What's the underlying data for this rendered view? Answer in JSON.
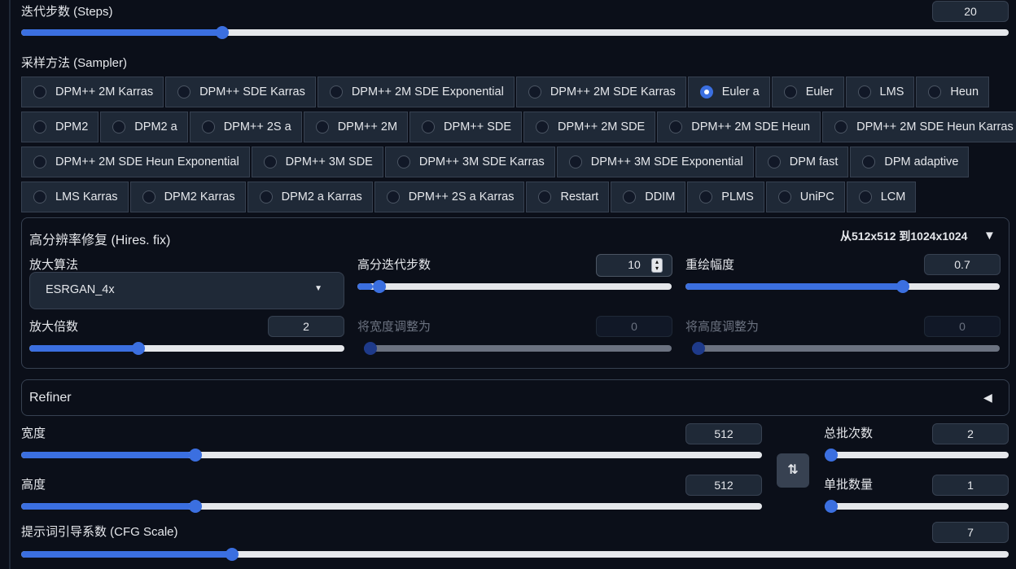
{
  "steps": {
    "label": "迭代步数 (Steps)",
    "value": "20",
    "progress": 0.2
  },
  "sampler": {
    "label": "采样方法 (Sampler)",
    "selected": "Euler a",
    "rows": [
      [
        "DPM++ 2M Karras",
        "DPM++ SDE Karras",
        "DPM++ 2M SDE Exponential",
        "DPM++ 2M SDE Karras",
        "Euler a",
        "Euler",
        "LMS",
        "Heun"
      ],
      [
        "DPM2",
        "DPM2 a",
        "DPM++ 2S a",
        "DPM++ 2M",
        "DPM++ SDE",
        "DPM++ 2M SDE",
        "DPM++ 2M SDE Heun",
        "DPM++ 2M SDE Heun Karras"
      ],
      [
        "DPM++ 2M SDE Heun Exponential",
        "DPM++ 3M SDE",
        "DPM++ 3M SDE Karras",
        "DPM++ 3M SDE Exponential",
        "DPM fast",
        "DPM adaptive"
      ],
      [
        "LMS Karras",
        "DPM2 Karras",
        "DPM2 a Karras",
        "DPM++ 2S a Karras",
        "Restart",
        "DDIM",
        "PLMS",
        "UniPC",
        "LCM"
      ]
    ]
  },
  "hires": {
    "title": "高分辨率修复 (Hires. fix)",
    "summary": "从512x512 到1024x1024",
    "toggle_icon": "▼",
    "upscaler": {
      "label": "放大算法",
      "value": "ESRGAN_4x"
    },
    "hires_steps": {
      "label": "高分迭代步数",
      "value": "10",
      "progress": 0.05
    },
    "denoise": {
      "label": "重绘幅度",
      "value": "0.7",
      "progress": 0.7
    },
    "scale": {
      "label": "放大倍数",
      "value": "2",
      "progress": 0.34
    },
    "resize_w": {
      "label": "将宽度调整为",
      "value": "0",
      "progress": 0
    },
    "resize_h": {
      "label": "将高度调整为",
      "value": "0",
      "progress": 0
    }
  },
  "refiner": {
    "title": "Refiner",
    "toggle_icon": "◀"
  },
  "width": {
    "label": "宽度",
    "value": "512",
    "progress": 0.23
  },
  "height": {
    "label": "高度",
    "value": "512",
    "progress": 0.23
  },
  "swap": {
    "icon": "⇅"
  },
  "batch_count": {
    "label": "总批次数",
    "value": "2",
    "progress": 0.0
  },
  "batch_size": {
    "label": "单批数量",
    "value": "1",
    "progress": 0.0
  },
  "cfg": {
    "label": "提示词引导系数 (CFG Scale)",
    "value": "7",
    "progress": 0.21
  },
  "colors": {
    "accent": "#3b6fe0",
    "background": "#0b0f19",
    "panel": "#1f2937"
  }
}
